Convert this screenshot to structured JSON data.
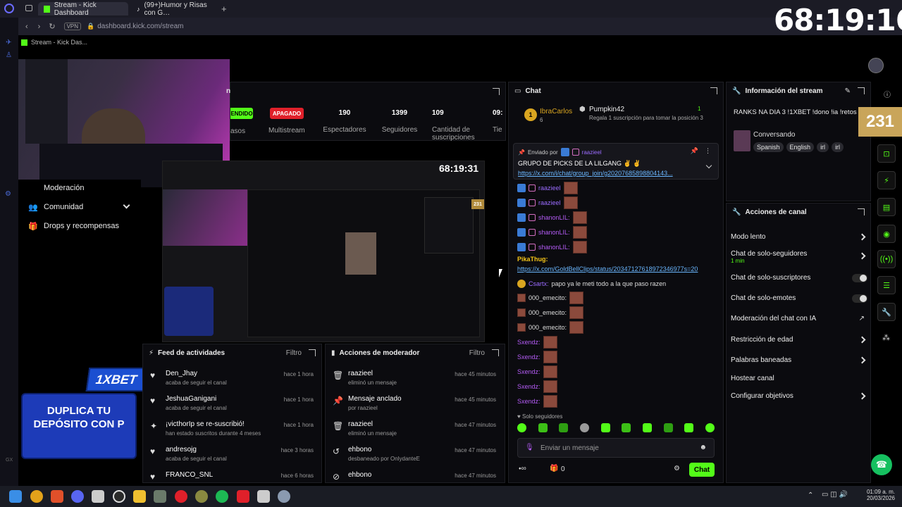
{
  "browser": {
    "tabs": [
      {
        "label": "Stream - Kick Dashboard"
      },
      {
        "label": "(99+)Humor y Risas con G…"
      }
    ],
    "vpn": "VPN",
    "url": "dashboard.kick.com/stream",
    "bookmark": "Stream - Kick Das..."
  },
  "overlay": {
    "timer": "68:19:16",
    "promo_brand": "1XBET",
    "promo_text": "DUPLICA TU DEPÓSITO CON P"
  },
  "stats_panel": {
    "title_partial": "n",
    "status_badge": "ENDIDO",
    "status_sub": "asos",
    "multistream_badge": "APAGADO",
    "multistream_label": "Multistream",
    "stats": [
      {
        "value": "190",
        "label": "Espectadores"
      },
      {
        "value": "1399",
        "label": "Seguidores"
      },
      {
        "value": "109",
        "label": "Cantidad de suscripciones"
      },
      {
        "value": "09:",
        "label": "Tie"
      }
    ]
  },
  "left_nav": {
    "items": [
      {
        "label": "Moderación"
      },
      {
        "label": "Comunidad"
      },
      {
        "label": "Drops y recompensas"
      }
    ]
  },
  "preview": {
    "timer": "68:19:31"
  },
  "activity_feed": {
    "title": "Feed de actividades",
    "filter": "Filtro",
    "items": [
      {
        "name": "Den_Jhay",
        "sub": "acaba de seguir el canal",
        "time": "hace 1 hora",
        "icon": "heart-icon"
      },
      {
        "name": "JeshuaGanigani",
        "sub": "acaba de seguir el canal",
        "time": "hace 1 hora",
        "icon": "heart-icon"
      },
      {
        "name": "¡victhorIp se re-suscribió!",
        "sub": "han estado suscritos durante 4 meses",
        "time": "hace 1 hora",
        "icon": "star-icon"
      },
      {
        "name": "andresojg",
        "sub": "acaba de seguir el canal",
        "time": "hace 3 horas",
        "icon": "heart-icon"
      },
      {
        "name": "FRANCO_SNL",
        "sub": "",
        "time": "hace 6 horas",
        "icon": "heart-icon"
      }
    ]
  },
  "mod_actions": {
    "title": "Acciones de moderador",
    "filter": "Filtro",
    "items": [
      {
        "name": "raazieel",
        "sub": "eliminó un mensaje",
        "time": "hace 45 minutos",
        "icon": "trash-icon"
      },
      {
        "name": "Mensaje anclado",
        "sub": "por raazieel",
        "time": "hace 45 minutos",
        "icon": "pin-icon"
      },
      {
        "name": "raazieel",
        "sub": "eliminó un mensaje",
        "time": "hace 47 minutos",
        "icon": "trash-icon"
      },
      {
        "name": "ehbono",
        "sub": "desbaneado por OnlydanteE",
        "time": "hace 47 minutos",
        "icon": "undo-icon"
      },
      {
        "name": "ehbono",
        "sub": "",
        "time": "hace 47 minutos",
        "icon": "ban-icon"
      }
    ]
  },
  "chat": {
    "title": "Chat",
    "top_gifter_1": {
      "name": "IbraCarlos",
      "count": "6"
    },
    "top_gifter_2": {
      "name": "Pumpkin42",
      "count": "1",
      "sub": "Regala 1 suscripción para tomar la posición 3"
    },
    "pinned": {
      "by_label": "Enviado por",
      "by_user": "raazieel",
      "title": "GRUPO DE PICKS DE LA LILGANG ✌️ ✌️",
      "link": "https://x.com/i/chat/group_join/g20207685898804143..."
    },
    "messages": [
      {
        "user": "raazieel",
        "color": "#9b6bff",
        "text": ""
      },
      {
        "user": "raazieel",
        "color": "#9b6bff",
        "text": ""
      },
      {
        "user": "shanonLIL:",
        "color": "#b55cf7",
        "text": ""
      },
      {
        "user": "shanonLIL:",
        "color": "#b55cf7",
        "text": ""
      },
      {
        "user": "shanonLIL:",
        "color": "#b55cf7",
        "text": ""
      }
    ],
    "pikathug_user": "PikaThug:",
    "pikathug_link": "https://x.com/GoldBellClips/status/20347127618972346977s=20",
    "csartx_user": "Csartx:",
    "csartx_text": "papo ya le meti todo a la que paso razen",
    "emecito_user": "000_emecito:",
    "sxendz_user": "Sxendz:",
    "followers_only": "Solo seguidores",
    "input_placeholder": "Enviar un mensaje",
    "bottom_count": "0",
    "send_button": "Chat"
  },
  "stream_info": {
    "title": "Información del stream",
    "stream_title": "RANKS NA DIA 3 !1XBET !dono !ia !retos",
    "category": "Conversando",
    "tags": [
      "Spanish",
      "English",
      "irl",
      "irl"
    ],
    "viewer_badge": "231"
  },
  "channel_actions": {
    "title": "Acciones de canal",
    "items": [
      {
        "label": "Modo lento",
        "sub": "",
        "control": "chevron"
      },
      {
        "label": "Chat de solo-seguidores",
        "sub": "1 min",
        "control": "chevron"
      },
      {
        "label": "Chat de solo-suscriptores",
        "sub": "",
        "control": "toggle"
      },
      {
        "label": "Chat de solo-emotes",
        "sub": "",
        "control": "toggle"
      },
      {
        "label": "Moderación del chat con IA",
        "sub": "",
        "control": "external"
      },
      {
        "label": "Restricción de edad",
        "sub": "",
        "control": "chevron"
      },
      {
        "label": "Palabras baneadas",
        "sub": "",
        "control": "chevron"
      },
      {
        "label": "Hostear canal",
        "sub": "",
        "control": "none"
      },
      {
        "label": "Configurar objetivos",
        "sub": "",
        "control": "chevron"
      }
    ]
  },
  "taskbar": {
    "time": "01:09 a. m.",
    "date": "20/03/2026"
  },
  "colors": {
    "kick_green": "#53fc18",
    "red_badge": "#e0202a",
    "panel_bg": "#0b0b0f"
  }
}
